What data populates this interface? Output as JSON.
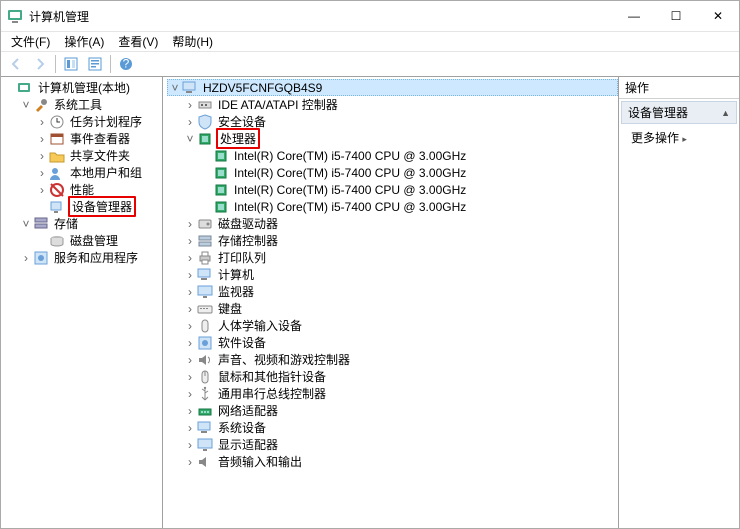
{
  "window": {
    "title": "计算机管理",
    "buttons": {
      "min": "—",
      "max": "☐",
      "close": "✕"
    }
  },
  "menu": {
    "file": "文件(F)",
    "action": "操作(A)",
    "view": "查看(V)",
    "help": "帮助(H)"
  },
  "left_tree": {
    "root": "计算机管理(本地)",
    "system_tools": "系统工具",
    "task_scheduler": "任务计划程序",
    "event_viewer": "事件查看器",
    "shared_folders": "共享文件夹",
    "local_users": "本地用户和组",
    "performance": "性能",
    "device_manager": "设备管理器",
    "storage": "存储",
    "disk_mgmt": "磁盘管理",
    "services": "服务和应用程序"
  },
  "center_tree": {
    "computer": "HZDV5FCNFGQB4S9",
    "ide": "IDE ATA/ATAPI 控制器",
    "security": "安全设备",
    "processors": "处理器",
    "cpu0": "Intel(R) Core(TM) i5-7400 CPU @ 3.00GHz",
    "cpu1": "Intel(R) Core(TM) i5-7400 CPU @ 3.00GHz",
    "cpu2": "Intel(R) Core(TM) i5-7400 CPU @ 3.00GHz",
    "cpu3": "Intel(R) Core(TM) i5-7400 CPU @ 3.00GHz",
    "disk_drives": "磁盘驱动器",
    "storage_ctl": "存储控制器",
    "print_queues": "打印队列",
    "computers": "计算机",
    "monitors": "监视器",
    "keyboards": "键盘",
    "hid": "人体学输入设备",
    "software": "软件设备",
    "audio_video_game": "声音、视频和游戏控制器",
    "mice": "鼠标和其他指针设备",
    "usb": "通用串行总线控制器",
    "network": "网络适配器",
    "system_devices": "系统设备",
    "display": "显示适配器",
    "audio_io": "音频输入和输出"
  },
  "actions": {
    "header": "操作",
    "category": "设备管理器",
    "more": "更多操作"
  }
}
